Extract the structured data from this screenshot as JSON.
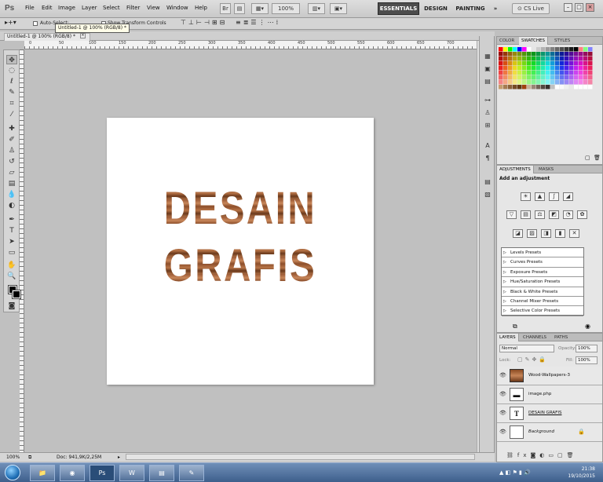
{
  "app": {
    "logo": "Ps"
  },
  "menu": [
    "File",
    "Edit",
    "Image",
    "Layer",
    "Select",
    "Filter",
    "View",
    "Window",
    "Help"
  ],
  "menubar": {
    "zoom": "100%",
    "workspaces": [
      "ESSENTIALS",
      "DESIGN",
      "PAINTING"
    ],
    "more": "»",
    "cs_live": "CS Live"
  },
  "options": {
    "auto_select_label": "Auto-Select:",
    "show_transform_label": "Show Transform Controls"
  },
  "tooltip": "Untitled-1 @ 100% (RGB/8) *",
  "document": {
    "tab_title": "Untitled-1 @ 100% (RGB/8) *",
    "line1": "DESAIN",
    "line2": "GRAFIS"
  },
  "ruler_numbers": [
    "0",
    "50",
    "100",
    "150",
    "200",
    "250",
    "300",
    "350",
    "400",
    "450",
    "500",
    "550",
    "600",
    "650",
    "700"
  ],
  "status": {
    "zoom": "100%",
    "doc_size": "Doc: 941,9K/2,25M"
  },
  "panels": {
    "swatch_tabs": [
      "COLOR",
      "SWATCHES",
      "STYLES"
    ],
    "adjust_tabs": [
      "ADJUSTMENTS",
      "MASKS"
    ],
    "adjust_title": "Add an adjustment",
    "presets": [
      "Levels Presets",
      "Curves Presets",
      "Exposure Presets",
      "Hue/Saturation Presets",
      "Black & White Presets",
      "Channel Mixer Presets",
      "Selective Color Presets"
    ],
    "layer_tabs": [
      "LAYERS",
      "CHANNELS",
      "PATHS"
    ],
    "blend_mode": "Normal",
    "opacity_label": "Opacity:",
    "opacity_value": "100%",
    "lock_label": "Lock:",
    "fill_label": "Fill:",
    "fill_value": "100%",
    "layers": [
      {
        "name": "Wood-Wallpapers-3",
        "type": "image"
      },
      {
        "name": "image.php",
        "type": "image"
      },
      {
        "name": "DESAIN GRAFIS",
        "type": "text"
      },
      {
        "name": "Background",
        "type": "background"
      }
    ]
  },
  "taskbar": {
    "time": "21:38",
    "date": "19/10/2015"
  }
}
